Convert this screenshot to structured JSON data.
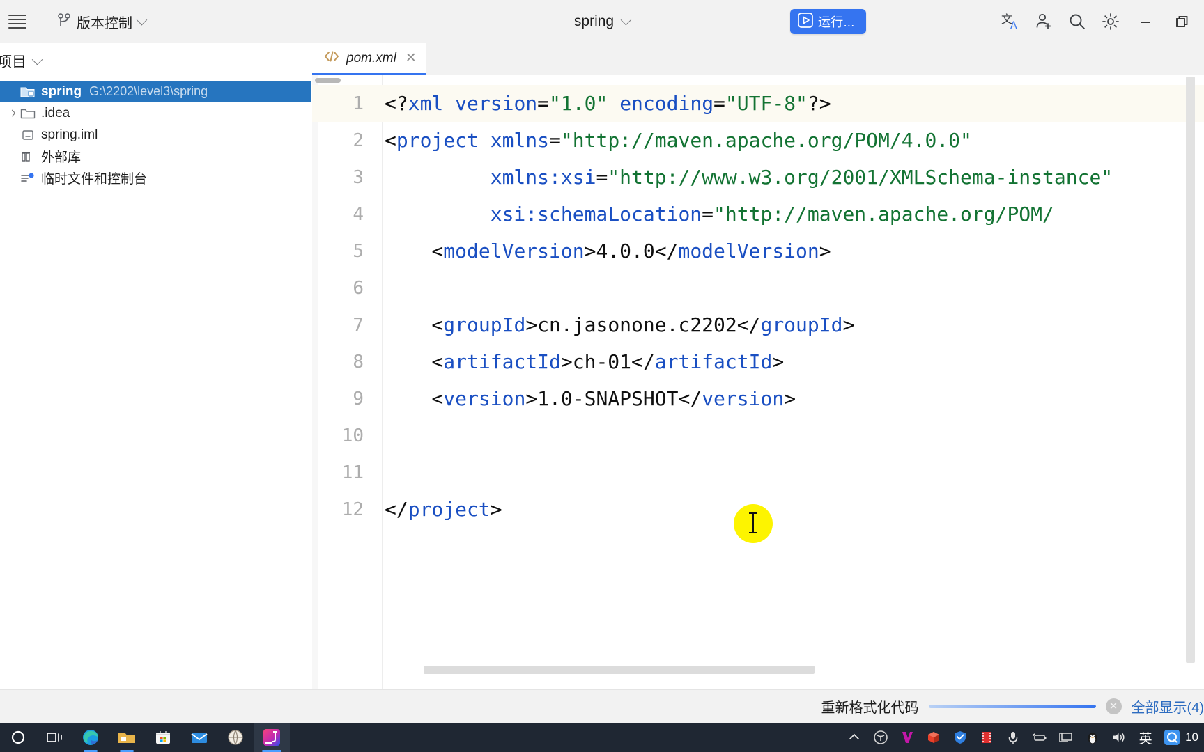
{
  "toolbar": {
    "menu_icon": "hamburger-menu-icon",
    "vcs_label": "版本控制",
    "vcs_icon": "branch-icon",
    "project_name": "spring",
    "run_label": "运行...",
    "run_icon": "play-icon",
    "icons": [
      {
        "name": "translate-icon",
        "glyph": "文A"
      },
      {
        "name": "add-user-icon",
        "glyph": "person-plus"
      },
      {
        "name": "search-icon",
        "glyph": "magnifier"
      },
      {
        "name": "settings-icon",
        "glyph": "gear"
      }
    ],
    "window_controls": [
      {
        "name": "minimize-button",
        "glyph": "—"
      },
      {
        "name": "restore-button",
        "glyph": "❐"
      }
    ],
    "accent_color": "#3574f0"
  },
  "sidebar": {
    "title": "项目",
    "tree": [
      {
        "label": "spring",
        "detail": "G:\\2202\\level3\\spring",
        "icon": "project-module-icon",
        "selected": true,
        "indent": 1,
        "arrow": false
      },
      {
        "label": ".idea",
        "detail": "",
        "icon": "folder-icon",
        "selected": false,
        "indent": 1,
        "arrow": true
      },
      {
        "label": "spring.iml",
        "detail": "",
        "icon": "iml-file-icon",
        "selected": false,
        "indent": 2,
        "arrow": false
      },
      {
        "label": "外部库",
        "detail": "",
        "icon": "external-libraries-icon",
        "selected": false,
        "indent": 1,
        "arrow": false
      },
      {
        "label": "临时文件和控制台",
        "detail": "",
        "icon": "scratches-consoles-icon",
        "selected": false,
        "indent": 1,
        "arrow": false
      }
    ],
    "selected_color": "#2675bf"
  },
  "editor": {
    "tab": {
      "name": "pom.xml",
      "icon": "xml-file-icon",
      "close_glyph": "✕"
    },
    "lines": [
      {
        "no": "1",
        "current": true,
        "tokens": [
          {
            "t": "pi",
            "v": "<?"
          },
          {
            "t": "tag",
            "v": "xml"
          },
          {
            "t": "pi",
            "v": " "
          },
          {
            "t": "attr",
            "v": "version"
          },
          {
            "t": "punc",
            "v": "="
          },
          {
            "t": "str",
            "v": "\"1.0\""
          },
          {
            "t": "pi",
            "v": " "
          },
          {
            "t": "attr",
            "v": "encoding"
          },
          {
            "t": "punc",
            "v": "="
          },
          {
            "t": "str",
            "v": "\"UTF-8\""
          },
          {
            "t": "pi",
            "v": "?>"
          }
        ]
      },
      {
        "no": "2",
        "current": false,
        "tokens": [
          {
            "t": "punc",
            "v": "<"
          },
          {
            "t": "tag",
            "v": "project"
          },
          {
            "t": "punc",
            "v": " "
          },
          {
            "t": "attr",
            "v": "xmlns"
          },
          {
            "t": "punc",
            "v": "="
          },
          {
            "t": "str",
            "v": "\"http://maven.apache.org/POM/4.0.0\""
          }
        ]
      },
      {
        "no": "3",
        "current": false,
        "tokens": [
          {
            "t": "punc",
            "v": "         "
          },
          {
            "t": "attr",
            "v": "xmlns:xsi"
          },
          {
            "t": "punc",
            "v": "="
          },
          {
            "t": "str",
            "v": "\"http://www.w3.org/2001/XMLSchema-instance\""
          }
        ]
      },
      {
        "no": "4",
        "current": false,
        "tokens": [
          {
            "t": "punc",
            "v": "         "
          },
          {
            "t": "attr",
            "v": "xsi:schemaLocation"
          },
          {
            "t": "punc",
            "v": "="
          },
          {
            "t": "str",
            "v": "\"http://maven.apache.org/POM/"
          }
        ]
      },
      {
        "no": "5",
        "current": false,
        "tokens": [
          {
            "t": "punc",
            "v": "    <"
          },
          {
            "t": "tag",
            "v": "modelVersion"
          },
          {
            "t": "punc",
            "v": ">"
          },
          {
            "t": "txt",
            "v": "4.0.0"
          },
          {
            "t": "punc",
            "v": "</"
          },
          {
            "t": "tag",
            "v": "modelVersion"
          },
          {
            "t": "punc",
            "v": ">"
          }
        ]
      },
      {
        "no": "6",
        "current": false,
        "tokens": []
      },
      {
        "no": "7",
        "current": false,
        "tokens": [
          {
            "t": "punc",
            "v": "    <"
          },
          {
            "t": "tag",
            "v": "groupId"
          },
          {
            "t": "punc",
            "v": ">"
          },
          {
            "t": "txt",
            "v": "cn.jasonone.c2202"
          },
          {
            "t": "punc",
            "v": "</"
          },
          {
            "t": "tag",
            "v": "groupId"
          },
          {
            "t": "punc",
            "v": ">"
          }
        ]
      },
      {
        "no": "8",
        "current": false,
        "tokens": [
          {
            "t": "punc",
            "v": "    <"
          },
          {
            "t": "tag",
            "v": "artifactId"
          },
          {
            "t": "punc",
            "v": ">"
          },
          {
            "t": "txt",
            "v": "ch-01"
          },
          {
            "t": "punc",
            "v": "</"
          },
          {
            "t": "tag",
            "v": "artifactId"
          },
          {
            "t": "punc",
            "v": ">"
          }
        ]
      },
      {
        "no": "9",
        "current": false,
        "tokens": [
          {
            "t": "punc",
            "v": "    <"
          },
          {
            "t": "tag",
            "v": "version"
          },
          {
            "t": "punc",
            "v": ">"
          },
          {
            "t": "txt",
            "v": "1.0-SNAPSHOT"
          },
          {
            "t": "punc",
            "v": "</"
          },
          {
            "t": "tag",
            "v": "version"
          },
          {
            "t": "punc",
            "v": ">"
          }
        ]
      },
      {
        "no": "10",
        "current": false,
        "tokens": []
      },
      {
        "no": "11",
        "current": false,
        "tokens": []
      },
      {
        "no": "12",
        "current": false,
        "tokens": [
          {
            "t": "punc",
            "v": "</"
          },
          {
            "t": "tag",
            "v": "project"
          },
          {
            "t": "punc",
            "v": ">"
          }
        ]
      }
    ],
    "colors": {
      "tag": "#1a4fc2",
      "string": "#137333",
      "text": "#0f0f0f",
      "current_line_bg": "#fcfaf2",
      "cursor_halo": "#fdf400"
    }
  },
  "statusbar": {
    "task_label": "重新格式化代码",
    "progress_percent": 100,
    "cancel_glyph": "✕",
    "show_all_label": "全部显示(4)"
  },
  "taskbar": {
    "items": [
      {
        "name": "start-search-icon",
        "glyph": "◯"
      },
      {
        "name": "task-view-icon",
        "glyph": "task-view"
      },
      {
        "name": "edge-browser-icon",
        "glyph": "edge"
      },
      {
        "name": "file-explorer-icon",
        "glyph": "folder"
      },
      {
        "name": "microsoft-store-icon",
        "glyph": "store"
      },
      {
        "name": "mail-icon",
        "glyph": "mail"
      },
      {
        "name": "browser-icon",
        "glyph": "globe"
      },
      {
        "name": "intellij-idea-icon",
        "glyph": "idea"
      }
    ],
    "tray": [
      {
        "name": "show-hidden-icons-chevron",
        "glyph": "︿"
      },
      {
        "name": "tray-app-1-icon",
        "glyph": "⊛"
      },
      {
        "name": "tray-app-2-icon",
        "glyph": "V"
      },
      {
        "name": "tray-app-3-icon",
        "glyph": "◆"
      },
      {
        "name": "tray-shield-icon",
        "glyph": "shield"
      },
      {
        "name": "tray-recorder-icon",
        "glyph": "film"
      },
      {
        "name": "tray-microphone-icon",
        "glyph": "mic"
      },
      {
        "name": "tray-battery-icon",
        "glyph": "battery"
      },
      {
        "name": "tray-display-icon",
        "glyph": "display"
      },
      {
        "name": "tray-penguin-icon",
        "glyph": "penguin"
      },
      {
        "name": "tray-volume-icon",
        "glyph": "volume"
      }
    ],
    "ime_label": "英",
    "qq_label": "Q",
    "clock": "10"
  }
}
